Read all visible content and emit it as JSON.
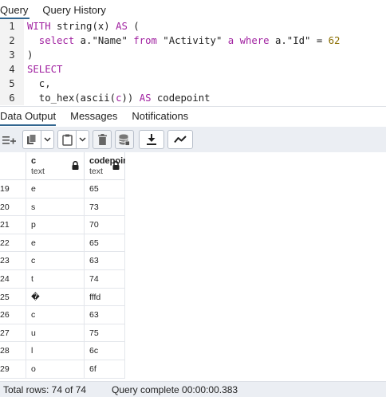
{
  "top_tabs": [
    {
      "label": "Query",
      "active": true
    },
    {
      "label": "Query History",
      "active": false
    }
  ],
  "editor": {
    "lines": [
      {
        "num": "1",
        "tokens": [
          {
            "t": "WITH",
            "c": "kw"
          },
          {
            "t": " string(x) ",
            "c": "dark"
          },
          {
            "t": "AS",
            "c": "kw"
          },
          {
            "t": " (",
            "c": "dark"
          }
        ]
      },
      {
        "num": "2",
        "tokens": [
          {
            "t": "  select",
            "c": "kw"
          },
          {
            "t": " a.\"Name\" ",
            "c": "dark"
          },
          {
            "t": "from",
            "c": "kw"
          },
          {
            "t": " \"Activity\" ",
            "c": "dark"
          },
          {
            "t": "a",
            "c": "kw"
          },
          {
            "t": " ",
            "c": "dark"
          },
          {
            "t": "where",
            "c": "kw"
          },
          {
            "t": " a.\"Id\" = ",
            "c": "dark"
          },
          {
            "t": "62",
            "c": "num"
          }
        ]
      },
      {
        "num": "3",
        "tokens": [
          {
            "t": ")",
            "c": "dark"
          }
        ]
      },
      {
        "num": "4",
        "tokens": [
          {
            "t": "SELECT",
            "c": "kw"
          }
        ]
      },
      {
        "num": "5",
        "tokens": [
          {
            "t": "  c,",
            "c": "dark"
          }
        ]
      },
      {
        "num": "6",
        "tokens": [
          {
            "t": "  to_hex(ascii(",
            "c": "dark"
          },
          {
            "t": "c",
            "c": "kw"
          },
          {
            "t": ")) ",
            "c": "dark"
          },
          {
            "t": "AS",
            "c": "kw"
          },
          {
            "t": " codepoint",
            "c": "dark"
          }
        ]
      }
    ]
  },
  "result_tabs": [
    {
      "label": "Data Output",
      "active": true
    },
    {
      "label": "Messages",
      "active": false
    },
    {
      "label": "Notifications",
      "active": false
    }
  ],
  "toolbar": {
    "buttons": [
      "add-row-icon",
      "copy-icon",
      "paste-icon",
      "delete-icon",
      "save-data-icon",
      "download-icon",
      "graph-icon"
    ]
  },
  "grid": {
    "columns": [
      {
        "name": "c",
        "type": "text"
      },
      {
        "name": "codepoint",
        "type": "text"
      }
    ],
    "rows": [
      {
        "num": "19",
        "c": "e",
        "codepoint": "65"
      },
      {
        "num": "20",
        "c": "s",
        "codepoint": "73"
      },
      {
        "num": "21",
        "c": "p",
        "codepoint": "70"
      },
      {
        "num": "22",
        "c": "e",
        "codepoint": "65"
      },
      {
        "num": "23",
        "c": "c",
        "codepoint": "63"
      },
      {
        "num": "24",
        "c": "t",
        "codepoint": "74"
      },
      {
        "num": "25",
        "c": "�",
        "codepoint": "fffd"
      },
      {
        "num": "26",
        "c": "c",
        "codepoint": "63"
      },
      {
        "num": "27",
        "c": "u",
        "codepoint": "75"
      },
      {
        "num": "28",
        "c": "l",
        "codepoint": "6c"
      },
      {
        "num": "29",
        "c": "o",
        "codepoint": "6f"
      }
    ]
  },
  "status": {
    "total_rows": "Total rows: 74 of 74",
    "query_status": "Query complete 00:00:00.383"
  },
  "colors": {
    "accent": "#326690",
    "keyword": "#a020a0",
    "number": "#8a6d00"
  }
}
